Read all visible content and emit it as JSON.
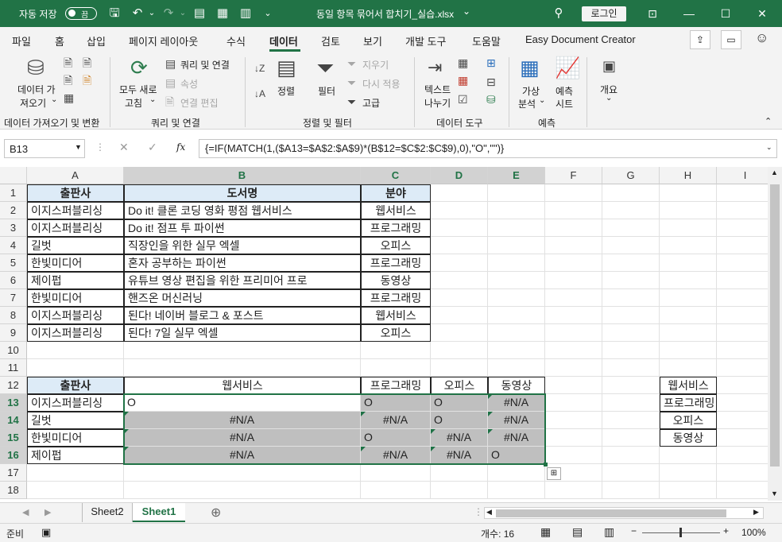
{
  "titlebar": {
    "autosave_label": "자동 저장",
    "toggle_state": "끔",
    "filename": "동일 항목 묶어서 합치기_실습.xlsx",
    "dropdown_arrow": "⌄",
    "login": "로그인",
    "colors": {
      "bg": "#217346"
    }
  },
  "menu": {
    "items": [
      "파일",
      "홈",
      "삽입",
      "페이지 레이아웃",
      "수식",
      "데이터",
      "검토",
      "보기",
      "개발 도구",
      "도움말",
      "Easy Document Creator"
    ],
    "active": "데이터"
  },
  "ribbon": {
    "get_data": {
      "line1": "데이터 가",
      "line2": "져오기",
      "arrow": "⌄",
      "group": "데이터 가져오기 및 변환"
    },
    "refresh": {
      "line1": "모두 새로",
      "line2": "고침",
      "arrow": "⌄"
    },
    "queries": {
      "item1": "쿼리 및 연결",
      "item2": "속성",
      "item3": "연결 편집",
      "group": "쿼리 및 연결"
    },
    "sort": {
      "label": "정렬"
    },
    "filter": {
      "label": "필터",
      "clear": "지우기",
      "reapply": "다시 적용",
      "advanced": "고급",
      "group": "정렬 및 필터"
    },
    "text_to_col": {
      "line1": "텍스트",
      "line2": "나누기",
      "group": "데이터 도구"
    },
    "whatif": {
      "line1": "가상",
      "line2": "분석",
      "arrow": "⌄"
    },
    "forecast": {
      "line1": "예측",
      "line2": "시트",
      "group": "예측"
    },
    "outline": {
      "label": "개요",
      "arrow": "⌄"
    }
  },
  "formula_bar": {
    "name_box": "B13",
    "formula": "{=IF(MATCH(1,($A13=$A$2:$A$9)*(B$12=$C$2:$C$9),0),\"O\",\"\")}",
    "fx": "fx"
  },
  "columns": [
    "A",
    "B",
    "C",
    "D",
    "E",
    "F",
    "G",
    "H",
    "I"
  ],
  "rows": [
    "1",
    "2",
    "3",
    "4",
    "5",
    "6",
    "7",
    "8",
    "9",
    "10",
    "11",
    "12",
    "13",
    "14",
    "15",
    "16",
    "17",
    "18"
  ],
  "table1": {
    "headers": [
      "출판사",
      "도서명",
      "분야"
    ],
    "rows": [
      [
        "이지스퍼블리싱",
        "Do it! 클론 코딩 영화 평점 웹서비스",
        "웹서비스"
      ],
      [
        "이지스퍼블리싱",
        "Do it! 점프 투 파이썬",
        "프로그래밍"
      ],
      [
        "길벗",
        "직장인을 위한 실무 엑셀",
        "오피스"
      ],
      [
        "한빛미디어",
        "혼자 공부하는 파이썬",
        "프로그래밍"
      ],
      [
        "제이펍",
        "유튜브 영상 편집을 위한 프리미어 프로",
        "동영상"
      ],
      [
        "한빛미디어",
        "핸즈온 머신러닝",
        "프로그래밍"
      ],
      [
        "이지스퍼블리싱",
        "된다! 네이버 블로그 & 포스트",
        "웹서비스"
      ],
      [
        "이지스퍼블리싱",
        "된다! 7일 실무 엑셀",
        "오피스"
      ]
    ]
  },
  "table2": {
    "corner": "출판사",
    "headers": [
      "웹서비스",
      "프로그래밍",
      "오피스",
      "동영상"
    ],
    "row_labels": [
      "이지스퍼블리싱",
      "길벗",
      "한빛미디어",
      "제이펍"
    ],
    "values": [
      [
        "O",
        "O",
        "O",
        "#N/A"
      ],
      [
        "#N/A",
        "#N/A",
        "O",
        "#N/A"
      ],
      [
        "#N/A",
        "O",
        "#N/A",
        "#N/A"
      ],
      [
        "#N/A",
        "#N/A",
        "#N/A",
        "O"
      ]
    ]
  },
  "list_h": [
    "웹서비스",
    "프로그래밍",
    "오피스",
    "동영상"
  ],
  "sheets": {
    "tabs": [
      "Sheet2",
      "Sheet1"
    ],
    "active": "Sheet1"
  },
  "status": {
    "mode": "준비",
    "count": "개수: 16",
    "zoom": "100%"
  }
}
